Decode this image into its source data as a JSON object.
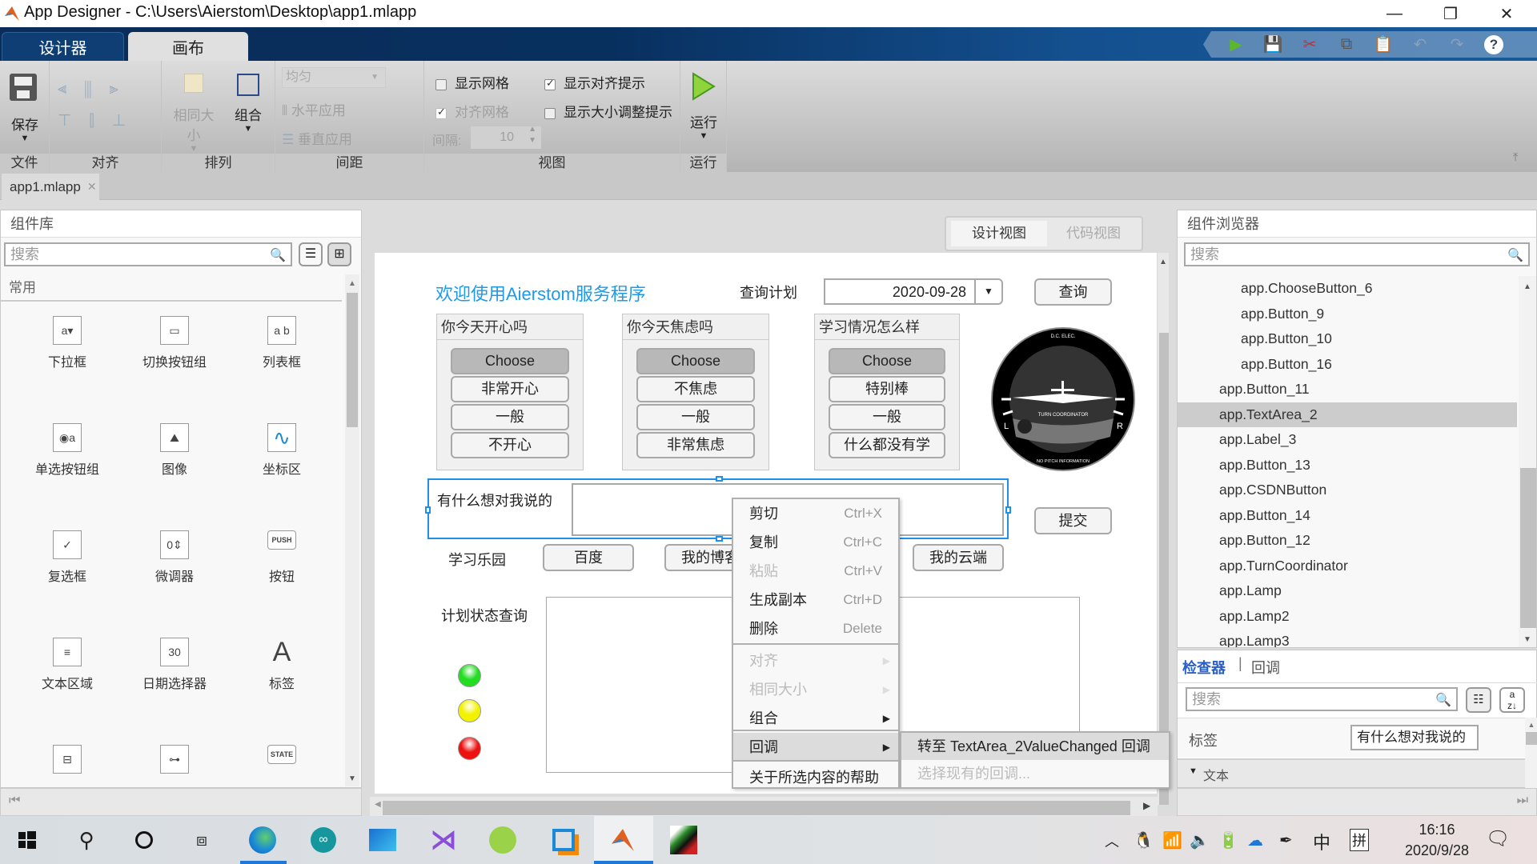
{
  "window": {
    "title": "App Designer - C:\\Users\\Aierstom\\Desktop\\app1.mlapp",
    "controls": {
      "minimize": "—",
      "restore": "❐",
      "close": "✕"
    }
  },
  "top_tabs": [
    {
      "label": "设计器",
      "active": false
    },
    {
      "label": "画布",
      "active": true
    }
  ],
  "quick_access": [
    "run-icon",
    "save-icon",
    "cut-icon",
    "copy-icon",
    "paste-icon",
    "undo-icon",
    "redo-icon",
    "help-icon"
  ],
  "ribbon": {
    "file": {
      "save_label": "保存",
      "section": "文件"
    },
    "align": {
      "section": "对齐"
    },
    "arrange": {
      "same_size_label": "相同大小",
      "group_label": "组合",
      "section": "排列"
    },
    "spacing": {
      "dropdown_value": "均匀",
      "horizontal_label": "水平应用",
      "vertical_label": "垂直应用",
      "section": "间距"
    },
    "view": {
      "show_grid": {
        "label": "显示网格",
        "checked": false
      },
      "snap_grid": {
        "label": "对齐网格",
        "checked": true,
        "disabled": true
      },
      "interval_label": "间隔:",
      "interval_value": "10",
      "show_align_hints": {
        "label": "显示对齐提示",
        "checked": true
      },
      "show_resize_hints": {
        "label": "显示大小调整提示",
        "checked": false
      },
      "section": "视图"
    },
    "run": {
      "label": "运行",
      "section": "运行"
    }
  },
  "doc_tab": {
    "name": "app1.mlapp",
    "close": "✕"
  },
  "component_library": {
    "title": "组件库",
    "search_placeholder": "搜索",
    "category": "常用",
    "items": [
      {
        "label": "下拉框",
        "icon": "dropdown-icon"
      },
      {
        "label": "切换按钮组",
        "icon": "toggle-button-group-icon"
      },
      {
        "label": "列表框",
        "icon": "listbox-icon"
      },
      {
        "label": "单选按钮组",
        "icon": "radio-group-icon"
      },
      {
        "label": "图像",
        "icon": "image-icon"
      },
      {
        "label": "坐标区",
        "icon": "axes-icon"
      },
      {
        "label": "复选框",
        "icon": "checkbox-icon"
      },
      {
        "label": "微调器",
        "icon": "spinner-icon"
      },
      {
        "label": "按钮",
        "icon": "push-button-icon"
      },
      {
        "label": "文本区域",
        "icon": "text-area-icon"
      },
      {
        "label": "日期选择器",
        "icon": "date-picker-icon"
      },
      {
        "label": "标签",
        "icon": "label-icon"
      },
      {
        "label": "",
        "icon": "tree-icon"
      },
      {
        "label": "",
        "icon": "slider-icon"
      },
      {
        "label": "",
        "icon": "state-button-icon"
      }
    ]
  },
  "view_toggle": {
    "design": "设计视图",
    "code": "代码视图"
  },
  "canvas": {
    "title": "欢迎使用Aierstom服务程序",
    "query_plan_label": "查询计划",
    "date_value": "2020-09-28",
    "query_button": "查询",
    "groups": [
      {
        "title": "你今天开心吗",
        "buttons": [
          "Choose",
          "非常开心",
          "一般",
          "不开心"
        ]
      },
      {
        "title": "你今天焦虑吗",
        "buttons": [
          "Choose",
          "不焦虑",
          "一般",
          "非常焦虑"
        ]
      },
      {
        "title": "学习情况怎么样",
        "buttons": [
          "Choose",
          "特别棒",
          "一般",
          "什么都没有学"
        ]
      }
    ],
    "gauge": {
      "top_text": "D.C. ELEC.",
      "center_text": "TURN COORDINATOR",
      "bottom_text": "NO PITCH INFORMATION",
      "left": "L",
      "right": "R"
    },
    "textarea_label": "有什么想对我说的",
    "submit_button": "提交",
    "links_label": "学习乐园",
    "link_buttons": [
      "百度",
      "我的博客",
      "我的云端"
    ],
    "status_label": "计划状态查询",
    "lamps": [
      {
        "color": "#22dd22"
      },
      {
        "color": "#f2f200"
      },
      {
        "color": "#ee1111"
      }
    ]
  },
  "context_menu": {
    "items": [
      {
        "label": "剪切",
        "shortcut": "Ctrl+X",
        "disabled": false
      },
      {
        "label": "复制",
        "shortcut": "Ctrl+C",
        "disabled": false
      },
      {
        "label": "粘贴",
        "shortcut": "Ctrl+V",
        "disabled": true
      },
      {
        "label": "生成副本",
        "shortcut": "Ctrl+D",
        "disabled": false
      },
      {
        "label": "删除",
        "shortcut": "Delete",
        "disabled": false
      },
      {
        "label": "对齐",
        "disabled": true,
        "submenu": true
      },
      {
        "label": "相同大小",
        "disabled": true,
        "submenu": true
      },
      {
        "label": "组合",
        "disabled": false,
        "submenu": true
      },
      {
        "label": "回调",
        "disabled": false,
        "submenu": true,
        "highlighted": true
      },
      {
        "label": "关于所选内容的帮助",
        "disabled": false
      }
    ],
    "submenu": [
      {
        "label": "转至 TextArea_2ValueChanged 回调",
        "disabled": false,
        "highlighted": true
      },
      {
        "label": "选择现有的回调...",
        "disabled": true
      }
    ]
  },
  "component_browser": {
    "title": "组件浏览器",
    "search_placeholder": "搜索",
    "tree": [
      {
        "label": "app.ChooseButton_6",
        "level": 2
      },
      {
        "label": "app.Button_9",
        "level": 2
      },
      {
        "label": "app.Button_10",
        "level": 2
      },
      {
        "label": "app.Button_16",
        "level": 2
      },
      {
        "label": "app.Button_11",
        "level": 1
      },
      {
        "label": "app.TextArea_2",
        "level": 1,
        "selected": true
      },
      {
        "label": "app.Label_3",
        "level": 1
      },
      {
        "label": "app.Button_13",
        "level": 1
      },
      {
        "label": "app.CSDNButton",
        "level": 1
      },
      {
        "label": "app.Button_14",
        "level": 1
      },
      {
        "label": "app.Button_12",
        "level": 1
      },
      {
        "label": "app.TurnCoordinator",
        "level": 1
      },
      {
        "label": "app.Lamp",
        "level": 1
      },
      {
        "label": "app.Lamp2",
        "level": 1
      },
      {
        "label": "app.Lamp3",
        "level": 1
      }
    ],
    "inspector_tab": "检查器",
    "callback_tab": "回调",
    "inspector_search_placeholder": "搜索",
    "property_label": "标签",
    "property_value": "有什么想对我说的",
    "section_text": "文本"
  },
  "taskbar": {
    "apps": [
      "windows-start-icon",
      "search-icon",
      "cortana-icon",
      "task-view-icon",
      "edge-icon",
      "arduino-icon",
      "mail-icon",
      "visual-studio-icon",
      "cloud-app-icon",
      "vmware-icon",
      "matlab-icon",
      "matlab-app-icon"
    ],
    "ime_lang": "中",
    "ime_mode": "拼",
    "time": "16:16",
    "date": "2020/9/28"
  }
}
